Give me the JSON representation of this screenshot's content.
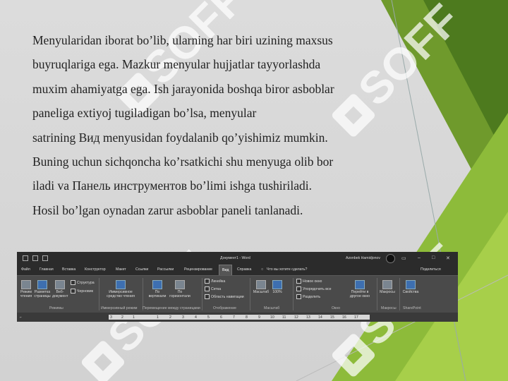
{
  "slide": {
    "lines": [
      "Menyularidan iborat bo’lib, ularning har biri uzining maxsus",
      "buyruqlariga ega. Mazkur menyular hujjatlar tayyorlashda",
      "muxim ahamiyatga ega. Ish jarayonida boshqa biror asboblar",
      "paneliga extiyoj tugiladigan bo’lsa, menyular",
      "satrining Вид menyusidan  foydalanib qo’yishimiz mumkin.",
      "Buning uchun sichqoncha ko’rsatkichi shu menyuga olib bor",
      "iladi va Панель инструментов bo’limi ishga tushiriladi.",
      "Hosil bo’lgan oynadan  zarur    asboblar paneli tanlanadi."
    ],
    "watermark": "SOFF"
  },
  "ribbon": {
    "doc_title": "Документ1 - Word",
    "user_name": "Azonbek Hamidjonov",
    "menu": [
      "Файл",
      "Главная",
      "Вставка",
      "Конструктор",
      "Макет",
      "Ссылки",
      "Рассылки",
      "Рецензирование",
      "Вид",
      "Справка",
      "Что вы хотите сделать?"
    ],
    "share": "Поделиться",
    "buttons": {
      "rezhim_chteniya": "Режим чтения",
      "razmetka": "Разметка страницы",
      "veb_dokument": "Веб-документ",
      "struktura": "Структура",
      "chernovik": "Черновик",
      "immersive": "Иммерсивное средство чтения",
      "vertikalno": "По вертикали",
      "gorizontalno": "По горизонтали",
      "lineika": "Линейка",
      "setka": "Сетка",
      "oblast_navigatsii": "Область навигации",
      "masshtab": "Масштаб",
      "zoom100": "100%",
      "novoe_okno": "Новое окно",
      "uporyadochit": "Упорядочить все",
      "razdelit": "Разделить",
      "pereiti": "Перейти в другое окно",
      "makrosy": "Макросы",
      "svoistva": "Свойства"
    },
    "groups": [
      "Режимы",
      "Иммерсивный режим",
      "Перемещение между страницами",
      "Отображение",
      "Масштаб",
      "Окно",
      "Макросы",
      "SharePoint"
    ],
    "ruler_numbers": [
      "3",
      "2",
      "1",
      "1",
      "2",
      "3",
      "4",
      "5",
      "6",
      "7",
      "8",
      "9",
      "10",
      "11",
      "12",
      "13",
      "14",
      "15",
      "16",
      "17"
    ]
  }
}
